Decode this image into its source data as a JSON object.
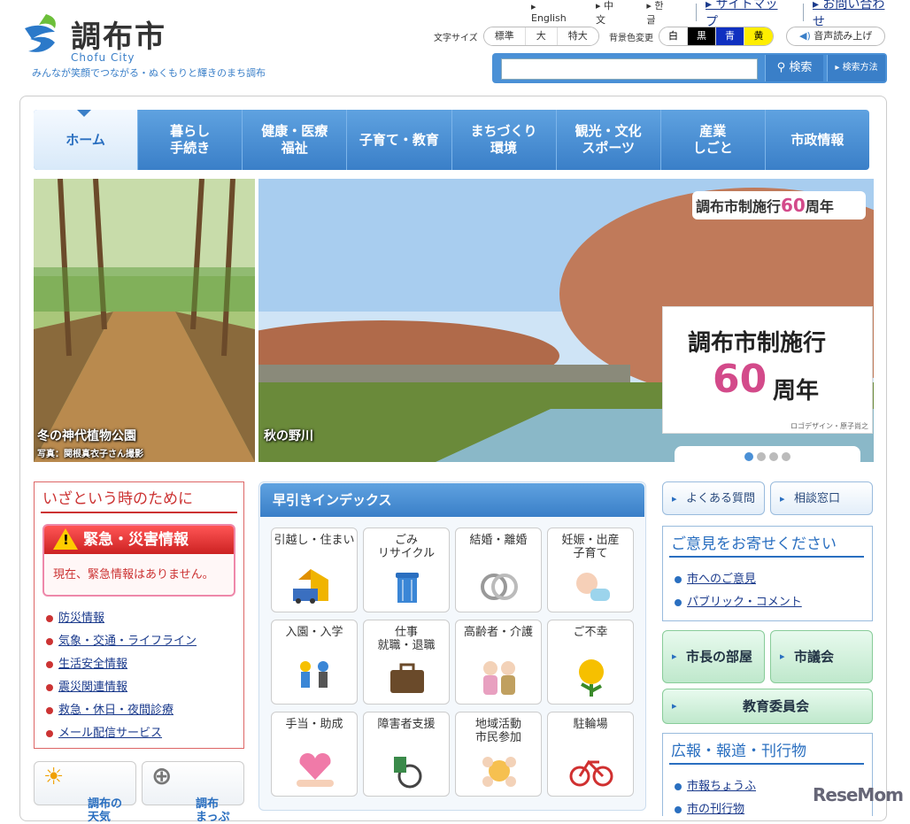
{
  "header": {
    "site_name": "調布市",
    "site_romaji": "Chofu City",
    "tagline": "みんなが笑顔でつながる・ぬくもりと輝きのまち調布",
    "lang_links": [
      "English",
      "中文",
      "한글"
    ],
    "sitemap": "サイトマップ",
    "contact": "お問い合わせ",
    "font_size_label": "文字サイズ",
    "font_sizes": [
      "標準",
      "大",
      "特大"
    ],
    "bg_label": "背景色変更",
    "bg_colors": [
      {
        "label": "白",
        "bg": "#ffffff",
        "fg": "#000000"
      },
      {
        "label": "黒",
        "bg": "#000000",
        "fg": "#ffffff"
      },
      {
        "label": "青",
        "bg": "#1030c0",
        "fg": "#ffffff"
      },
      {
        "label": "黄",
        "bg": "#ffee00",
        "fg": "#000000"
      }
    ],
    "voice": "音声読み上げ",
    "search_button": "検索",
    "search_method": "検索方法"
  },
  "nav": [
    "ホーム",
    "暮らし\n手続き",
    "健康・医療\n福祉",
    "子育て・教育",
    "まちづくり\n環境",
    "観光・文化\nスポーツ",
    "産業\nしごと",
    "市政情報"
  ],
  "banners": {
    "left_caption": "冬の神代植物公園",
    "left_credit": "写真：関根真衣子さん撮影",
    "right_caption": "秋の野川",
    "anniv_top": "調布市制施行",
    "anniv_top_suffix": "周年",
    "anniv_box_title": "調布市制施行",
    "anniv_box_suffix": "周年",
    "anniv_number": "60",
    "anniv_credit": "ロゴデザイン・原子尚之"
  },
  "emergency": {
    "title": "いざという時のために",
    "head": "緊急・災害情報",
    "message": "現在、緊急情報はありません。",
    "links": [
      "防災情報",
      "気象・交通・ライフライン",
      "生活安全情報",
      "震災関連情報",
      "救急・休日・夜間診療",
      "メール配信サービス"
    ]
  },
  "mini": [
    "調布の\n天気",
    "調布\nまっぷ"
  ],
  "index": {
    "title": "早引きインデックス",
    "items": [
      "引越し・住まい",
      "ごみ\nリサイクル",
      "結婚・離婚",
      "妊娠・出産\n子育て",
      "入園・入学",
      "仕事\n就職・退職",
      "高齢者・介護",
      "ご不幸",
      "手当・助成",
      "障害者支援",
      "地域活動\n市民参加",
      "駐輪場"
    ]
  },
  "right": {
    "faq": "よくある質問",
    "consult": "相談窓口",
    "opinion_title": "ご意見をお寄せください",
    "opinion_links": [
      "市へのご意見",
      "パブリック・コメント"
    ],
    "mayor": "市長の部屋",
    "council": "市議会",
    "board": "教育委員会",
    "pr_title": "広報・報道・刊行物",
    "pr_links": [
      "市報ちょうふ",
      "市の刊行物"
    ]
  },
  "watermark": "ReseMom"
}
